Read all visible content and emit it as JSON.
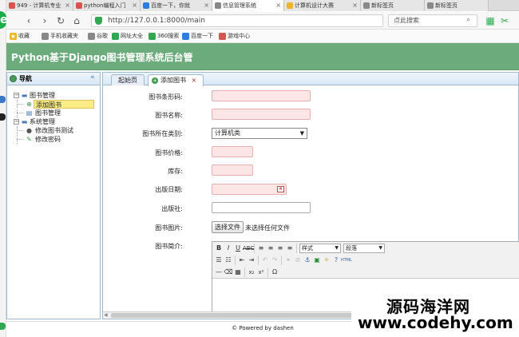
{
  "browser": {
    "tabs": [
      {
        "label": "949 - 计算机专业",
        "color": "#d9534f",
        "active": false
      },
      {
        "label": "python编程入门",
        "color": "#d9534f",
        "active": false
      },
      {
        "label": "百度一下，你就",
        "color": "#2d7de0",
        "active": false
      },
      {
        "label": "信息管理系统",
        "color": "#888888",
        "active": true
      },
      {
        "label": "计算机设计大赛",
        "color": "#f0b429",
        "active": false
      },
      {
        "label": "新标签页",
        "color": "#888888",
        "active": false
      },
      {
        "label": "新标签页",
        "color": "#888888",
        "active": false
      }
    ],
    "address": "http://127.0.0.1:8000/main",
    "search_placeholder": "点此搜索",
    "bookmarks": [
      {
        "label": "收藏",
        "color": "#f0b429"
      },
      {
        "label": "手机收藏夹",
        "color": "#888888"
      },
      {
        "label": "谷歌",
        "color": "#888888"
      },
      {
        "label": "网址大全",
        "color": "#2fa84f"
      },
      {
        "label": "360搜索",
        "color": "#2fa84f"
      },
      {
        "label": "百度一下",
        "color": "#2d7de0"
      },
      {
        "label": "游戏中心",
        "color": "#d9534f"
      }
    ]
  },
  "app": {
    "title": "Python基于Django图书管理系统后台管",
    "header_color": "#6cab7c"
  },
  "sidebar": {
    "title": "导航",
    "tree": [
      {
        "label": "图书管理",
        "level": 0,
        "icon": "folder-icon",
        "toggle": "−"
      },
      {
        "label": "添加图书",
        "level": 1,
        "icon": "add-icon",
        "selected": true
      },
      {
        "label": "图书管理",
        "level": 1,
        "icon": "book-icon"
      },
      {
        "label": "系统管理",
        "level": 0,
        "icon": "folder-icon",
        "toggle": "−"
      },
      {
        "label": "修改图书测试",
        "level": 1,
        "icon": "user-icon"
      },
      {
        "label": "修改密码",
        "level": 1,
        "icon": "pencil-icon"
      }
    ]
  },
  "main": {
    "tabs": [
      {
        "label": "起始页",
        "active": false
      },
      {
        "label": "添加图书",
        "active": true
      }
    ],
    "form": {
      "barcode_label": "图书条形码:",
      "name_label": "图书名称:",
      "category_label": "图书所在类别:",
      "category_value": "计算机类",
      "price_label": "图书价格:",
      "stock_label": "库存:",
      "pubdate_label": "出版日期:",
      "publisher_label": "出版社:",
      "image_label": "图书图片:",
      "file_button": "选择文件",
      "file_status": "未选择任何文件",
      "intro_label": "图书简介:"
    },
    "editor": {
      "style_select": "样式",
      "paragraph_select": "段落"
    }
  },
  "footer": {
    "text": "© Powered by dashen"
  },
  "watermark": {
    "line1": "源码海洋网",
    "line2": "www.codehy.com"
  }
}
